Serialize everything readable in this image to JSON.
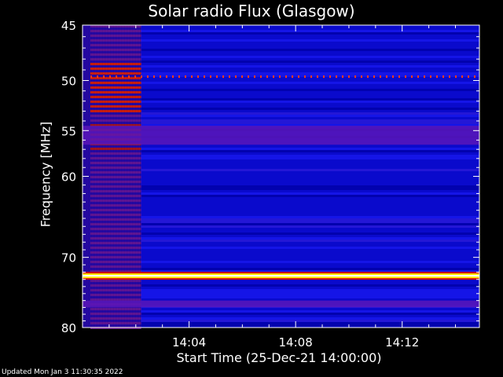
{
  "title": "Solar radio Flux (Glasgow)",
  "footer": "Updated Mon Jan  3 11:30:35 2022",
  "chart_data": {
    "type": "heatmap",
    "title": "Solar radio Flux (Glasgow)",
    "xlabel": "Start Time (25-Dec-21 14:00:00)",
    "ylabel": "Frequency [MHz]",
    "x_ticks": [
      "14:04",
      "14:08",
      "14:12"
    ],
    "x_tick_minutes": [
      4,
      8,
      12
    ],
    "xlim_minutes": [
      0,
      14.9
    ],
    "y_ticks": [
      45,
      50,
      55,
      60,
      70,
      80
    ],
    "ylim": [
      45,
      80
    ],
    "y_scale": "log",
    "grid": false,
    "colormap": [
      "#000000",
      "#0000ff",
      "#ff0000",
      "#ffff00",
      "#ffffff"
    ],
    "features": [
      {
        "name": "burst",
        "minutes": [
          0,
          2.2
        ],
        "freq": [
          45,
          80
        ]
      },
      {
        "name": "interference line",
        "freq": 72.5
      },
      {
        "name": "interference line",
        "freq": 49.6
      },
      {
        "name": "band",
        "freq": [
          54.5,
          56.5
        ]
      },
      {
        "name": "band",
        "freq": [
          76,
          77
        ]
      }
    ]
  }
}
